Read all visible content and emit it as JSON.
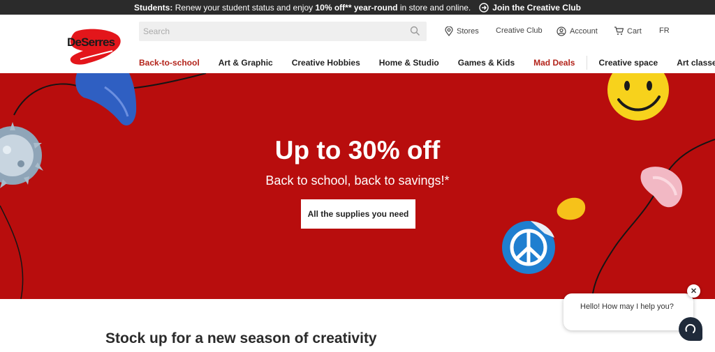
{
  "banner": {
    "lead": "Students:",
    "text_a": " Renew your student status and enjoy ",
    "highlight": "10% off** year-round",
    "text_b": " in store and online.",
    "join_label": "Join the Creative Club"
  },
  "header": {
    "logo_text": "DeSerres",
    "search_placeholder": "Search",
    "utility": {
      "stores": "Stores",
      "creative_club": "Creative Club",
      "account": "Account",
      "cart": "Cart",
      "lang": "FR"
    }
  },
  "nav": {
    "items": [
      {
        "label": "Back-to-school"
      },
      {
        "label": "Art & Graphic"
      },
      {
        "label": "Creative Hobbies"
      },
      {
        "label": "Home & Studio"
      },
      {
        "label": "Games & Kids"
      },
      {
        "label": "Mad Deals"
      },
      {
        "label": "Creative space"
      },
      {
        "label": "Art classes"
      }
    ]
  },
  "hero": {
    "title": "Up to 30% off",
    "subtitle": "Back to school, back to savings!*",
    "cta": "All the supplies you need"
  },
  "section": {
    "title": "Stock up for a new season of creativity"
  },
  "chat": {
    "message": "Hello! How may I help you?",
    "close": "✕"
  },
  "colors": {
    "hero_bg": "#b80d0d",
    "accent_red": "#b3231a",
    "topbar_bg": "#2b2b2b"
  }
}
